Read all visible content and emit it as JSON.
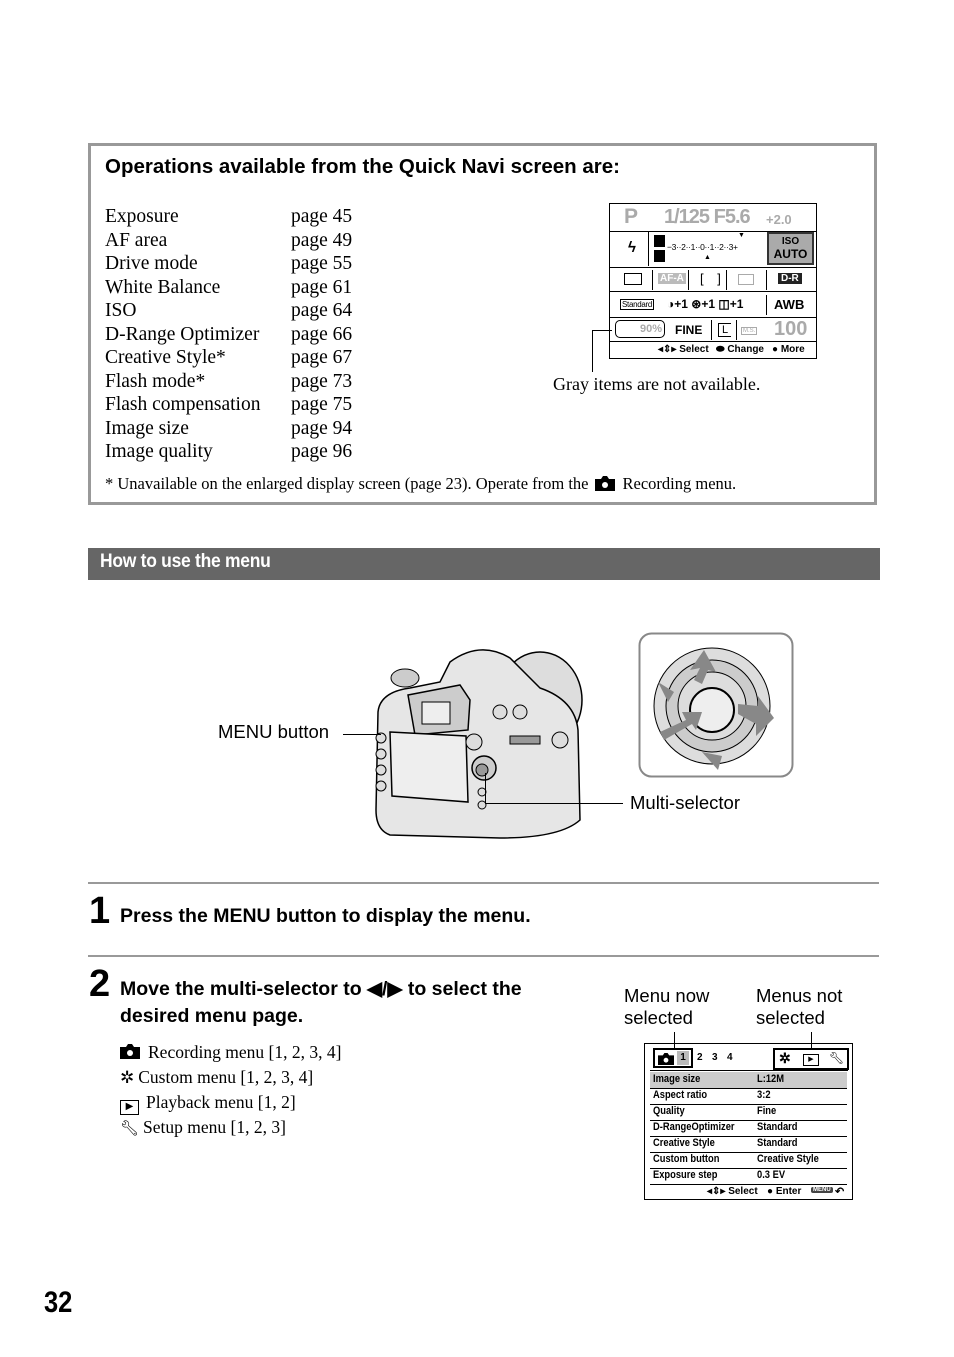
{
  "quick_navi_box": {
    "title": "Operations available from the Quick Navi screen are:",
    "operations": [
      {
        "name": "Exposure",
        "page": "page 45"
      },
      {
        "name": "AF area",
        "page": "page 49"
      },
      {
        "name": "Drive mode",
        "page": "page 55"
      },
      {
        "name": "White Balance",
        "page": "page 61"
      },
      {
        "name": "ISO",
        "page": "page 64"
      },
      {
        "name": "D-Range Optimizer",
        "page": "page 66"
      },
      {
        "name": "Creative Style*",
        "page": "page 67"
      },
      {
        "name": "Flash mode*",
        "page": "page 73"
      },
      {
        "name": "Flash compensation",
        "page": "page 75"
      },
      {
        "name": "Image size",
        "page": "page 94"
      },
      {
        "name": "Image quality",
        "page": "page 96"
      }
    ],
    "footnote_before": "* Unavailable on the enlarged display screen (page 23). Operate from the",
    "footnote_icon": "camera-icon",
    "footnote_after": "Recording menu.",
    "gray_note": "Gray items are not available.",
    "screen": {
      "mode": "P",
      "shutter_aperture": "1/125 F5.6",
      "exp_comp": "+2.0",
      "scale": "−3··2··1··0··1··2··3+",
      "iso_label": "ISO",
      "iso_value": "AUTO",
      "af_mode": "AF-A",
      "dr": "D-R",
      "style": "Standard",
      "contrast": "+1",
      "saturation": "+1",
      "sharpness": "+1",
      "wb": "AWB",
      "battery": "90%",
      "quality": "FINE",
      "size": "L",
      "metering": "M.S.",
      "iso_num": "100",
      "help_select": "Select",
      "help_change": "Change",
      "help_more": "More"
    }
  },
  "section": {
    "title": "How to use the menu"
  },
  "illustration": {
    "menu_button_label": "MENU button",
    "multi_selector_label": "Multi-selector"
  },
  "steps": [
    {
      "number": "1",
      "text": "Press the MENU button to display the menu."
    },
    {
      "number": "2",
      "text_line1": "Move the multi-selector to ◀/▶ to select the",
      "text_line2": "desired menu page."
    }
  ],
  "menu_pages": [
    {
      "icon": "camera-icon",
      "label": "Recording menu [1, 2, 3, 4]"
    },
    {
      "icon": "gear-icon",
      "label": "Custom menu [1, 2, 3, 4]"
    },
    {
      "icon": "playback-icon",
      "label": "Playback menu [1, 2]"
    },
    {
      "icon": "wrench-icon",
      "label": "Setup menu [1, 2, 3]"
    }
  ],
  "menu_screen": {
    "label_selected": [
      "Menu now",
      "selected"
    ],
    "label_not_selected": [
      "Menus not",
      "selected"
    ],
    "tabs": [
      "1",
      "2",
      "3",
      "4"
    ],
    "rows": [
      {
        "item": "Image size",
        "value": "L:12M"
      },
      {
        "item": "Aspect ratio",
        "value": "3:2"
      },
      {
        "item": "Quality",
        "value": "Fine"
      },
      {
        "item": "D-RangeOptimizer",
        "value": "Standard"
      },
      {
        "item": "Creative Style",
        "value": "Standard"
      },
      {
        "item": "Custom button",
        "value": "Creative Style"
      },
      {
        "item": "Exposure step",
        "value": "0.3 EV"
      }
    ],
    "help_select": "Select",
    "help_enter": "Enter",
    "help_menu": "MENU"
  },
  "page_number": "32"
}
